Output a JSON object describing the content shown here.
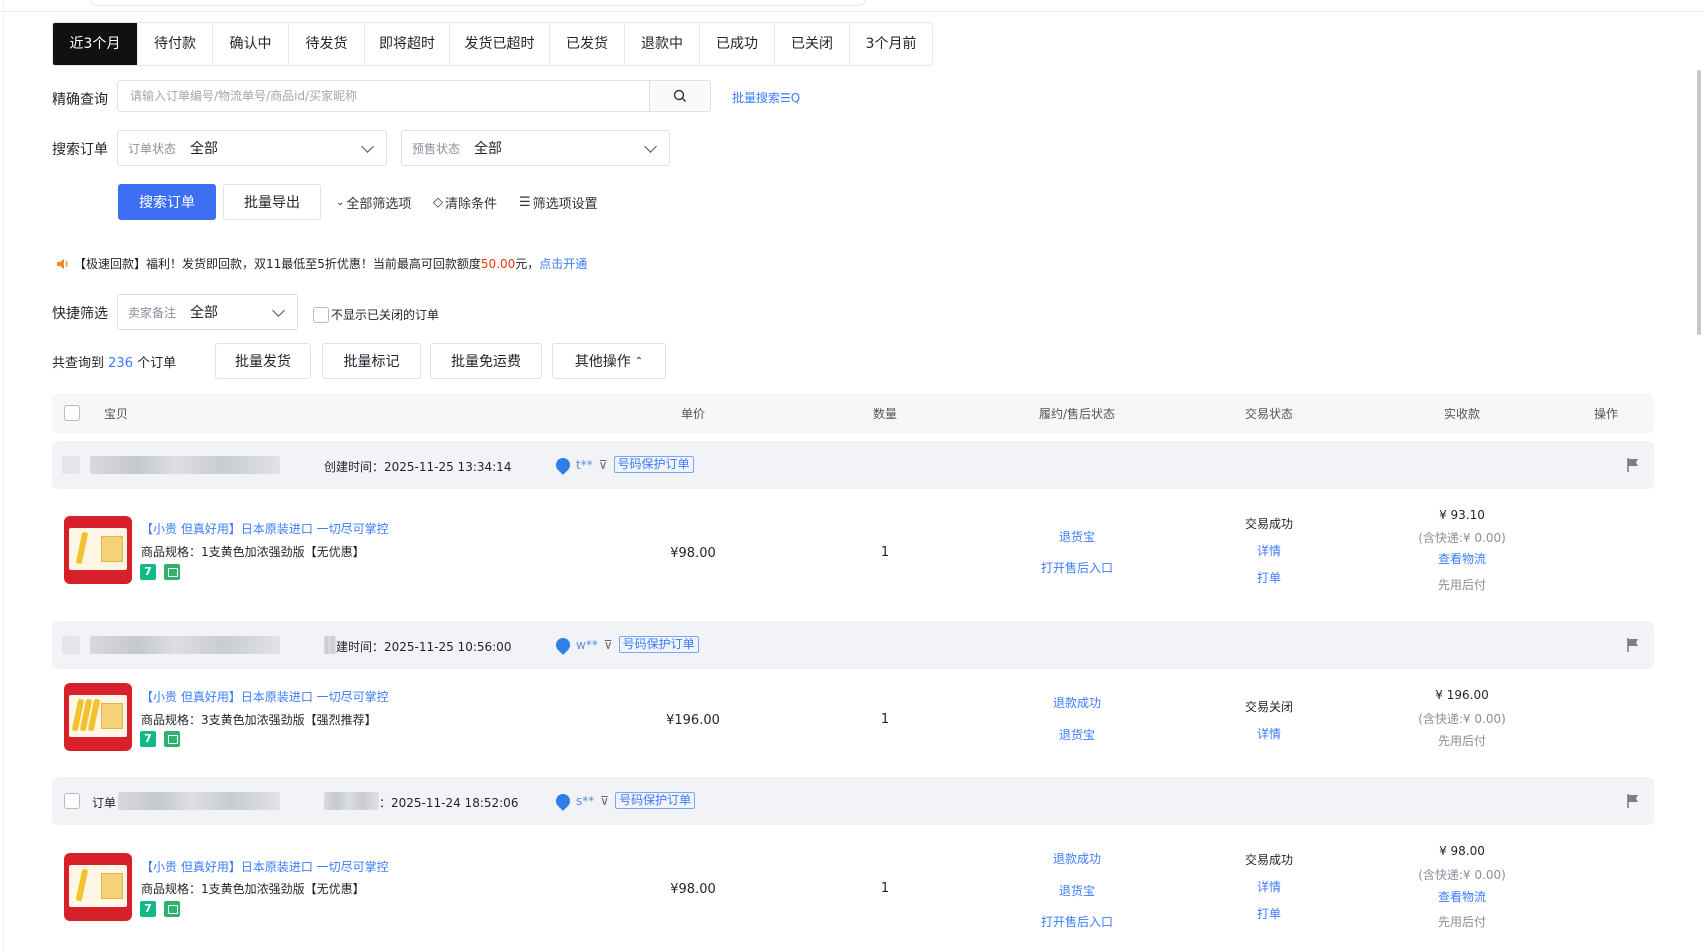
{
  "tabs": [
    {
      "label": "近3个月",
      "active": true
    },
    {
      "label": "待付款"
    },
    {
      "label": "确认中"
    },
    {
      "label": "待发货"
    },
    {
      "label": "即将超时"
    },
    {
      "label": "发货已超时"
    },
    {
      "label": "已发货"
    },
    {
      "label": "退款中"
    },
    {
      "label": "已成功"
    },
    {
      "label": "已关闭"
    },
    {
      "label": "3个月前"
    }
  ],
  "precise_search": {
    "label": "精确查询",
    "placeholder": "请输入订单编号/物流单号/商品id/买家昵称",
    "batch_link": "批量搜索☰Q"
  },
  "search_orders": {
    "label": "搜索订单",
    "order_status": {
      "key": "订单状态",
      "value": "全部"
    },
    "presale_status": {
      "key": "预售状态",
      "value": "全部"
    }
  },
  "actions": {
    "search_btn": "搜索订单",
    "export_btn": "批量导出",
    "all_filters": "全部筛选项",
    "clear": "清除条件",
    "filter_settings": "筛选项设置"
  },
  "notice": {
    "prefix": "【极速回款】福利！发货即回款，双11最低至5折优惠！当前最高可回款额度",
    "amount": "50.00",
    "suffix": "元，",
    "link": "点击开通"
  },
  "quick_filter": {
    "label": "快捷筛选",
    "seller_note": {
      "key": "卖家备注",
      "value": "全部"
    },
    "hide_closed": "不显示已关闭的订单"
  },
  "summary": {
    "prefix": "共查询到",
    "count": "236",
    "suffix": "个订单"
  },
  "bulk": {
    "ship": "批量发货",
    "mark": "批量标记",
    "free_shipping": "批量免运费",
    "other": "其他操作"
  },
  "table_header": {
    "item": "宝贝",
    "price": "单价",
    "qty": "数量",
    "after_sale": "履约/售后状态",
    "trade": "交易状态",
    "received": "实收款",
    "ops": "操作"
  },
  "orders": [
    {
      "created": "创建时间：2025-11-25 13:34:14",
      "buyer": "t**",
      "protect_badge": "号码保护订单",
      "title": "【小贵 但真好用】日本原装进口 一切尽可掌控",
      "spec": "商品规格：1支黄色加浓强劲版【无优惠】",
      "tag7": "7",
      "price": "¥98.00",
      "qty": "1",
      "after_sale": [
        "退货宝",
        "打开售后入口"
      ],
      "trade_status": "交易成功",
      "trade_links": [
        "详情",
        "打单"
      ],
      "received": "¥ 93.10",
      "shipping": "(含快递:¥ 0.00)",
      "logistics": "查看物流",
      "pay_note": "先用后付"
    },
    {
      "created": "建时间：2025-11-25 10:56:00",
      "buyer": "w**",
      "protect_badge": "号码保护订单",
      "title": "【小贵 但真好用】日本原装进口 一切尽可掌控",
      "spec": "商品规格：3支黄色加浓强劲版【强烈推荐】",
      "tag7": "7",
      "price": "¥196.00",
      "qty": "1",
      "after_sale": [
        "退款成功",
        "退货宝"
      ],
      "trade_status": "交易关闭",
      "trade_links": [
        "详情"
      ],
      "received": "¥ 196.00",
      "shipping": "(含快递:¥ 0.00)",
      "pay_note": "先用后付"
    },
    {
      "order_label": "订单",
      "created": "：2025-11-24 18:52:06",
      "buyer": "s**",
      "protect_badge": "号码保护订单",
      "title": "【小贵 但真好用】日本原装进口 一切尽可掌控",
      "spec": "商品规格：1支黄色加浓强劲版【无优惠】",
      "tag7": "7",
      "price": "¥98.00",
      "qty": "1",
      "after_sale": [
        "退款成功",
        "退货宝",
        "打开售后入口"
      ],
      "trade_status": "交易成功",
      "trade_links": [
        "详情",
        "打单"
      ],
      "received": "¥ 98.00",
      "shipping": "(含快递:¥ 0.00)",
      "logistics": "查看物流",
      "pay_note": "先用后付"
    }
  ],
  "colors": {
    "primary": "#3d6ff5",
    "link": "#3b7cff",
    "accent_red": "#e8380d",
    "tab_active": "#111111"
  }
}
